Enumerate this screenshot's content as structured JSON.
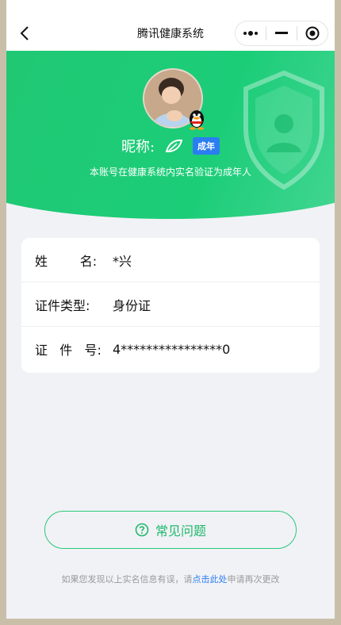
{
  "navbar": {
    "title": "腾讯健康系统",
    "back_icon": "chevron-left-icon",
    "more_icon": "more-icon",
    "minimize_icon": "minimize-icon",
    "close_icon": "target-icon"
  },
  "profile": {
    "nickname_label": "昵称:",
    "adult_badge": "成年",
    "subtitle": "本账号在健康系统内实名验证为成年人"
  },
  "info": {
    "rows": [
      {
        "label": "姓        名:",
        "value": "*兴"
      },
      {
        "label": "证件类型:",
        "value": "身份证"
      },
      {
        "label": "证   件   号:",
        "value": "4****************0"
      }
    ]
  },
  "faq": {
    "label": "常见问题",
    "icon": "question-circle-icon"
  },
  "footer": {
    "prefix": "如果您发现以上实名信息有误，请",
    "link": "点击此处",
    "suffix": "申请再次更改"
  },
  "colors": {
    "brand_green": "#21c773",
    "link_blue": "#2b7df2",
    "background": "#f1f2f6"
  }
}
